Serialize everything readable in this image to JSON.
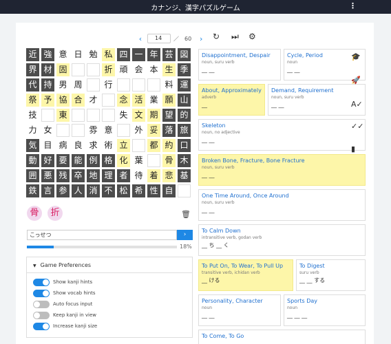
{
  "app": {
    "title": "カナンジ、漢字パズルゲーム",
    "menu_icon": "kebab-icon"
  },
  "pager": {
    "prev": "‹",
    "next": "›",
    "page": "14",
    "sep": "／",
    "total": "60"
  },
  "controls": {
    "restart_icon": "↻",
    "skip_icon": "⏭",
    "tools_icon": "⚙"
  },
  "board": {
    "rows": [
      [
        "近",
        "強",
        "意",
        "日",
        "勉",
        "私",
        "四",
        "一",
        "年",
        "芸",
        "図"
      ],
      [
        "界",
        "材",
        "固",
        "",
        "",
        "折",
        "頑",
        "会",
        "本",
        "生",
        "季"
      ],
      [
        "代",
        "持",
        "男",
        "周",
        "",
        "行",
        "",
        "",
        "",
        "料",
        "運"
      ],
      [
        "祭",
        "予",
        "協",
        "合",
        "才",
        "",
        "念",
        "活",
        "業",
        "願",
        "山"
      ],
      [
        "技",
        "",
        "東",
        "",
        "",
        "",
        "失",
        "文",
        "期",
        "望",
        "的"
      ],
      [
        "力",
        "女",
        "",
        "",
        "雰",
        "意",
        "",
        "外",
        "妥",
        "落",
        "旅"
      ],
      [
        "気",
        "目",
        "病",
        "良",
        "求",
        "術",
        "立",
        "",
        "都",
        "約",
        "口"
      ],
      [
        "動",
        "好",
        "要",
        "能",
        "例",
        "格",
        "化",
        "葉",
        "",
        "骨",
        "木"
      ],
      [
        "囲",
        "悪",
        "残",
        "卒",
        "地",
        "理",
        "者",
        "待",
        "着",
        "悲",
        "基"
      ],
      [
        "鉄",
        "言",
        "参",
        "人",
        "消",
        "不",
        "松",
        "希",
        "性",
        "自",
        ""
      ]
    ],
    "styles": [
      [
        "d",
        "d",
        "w",
        "w",
        "w",
        "y",
        "d",
        "d",
        "d",
        "d",
        "d"
      ],
      [
        "d",
        "d",
        "y",
        "e",
        "e",
        "y",
        "w",
        "w",
        "w",
        "y",
        "d"
      ],
      [
        "d",
        "d",
        "w",
        "w",
        "e",
        "w",
        "e",
        "e",
        "e",
        "w",
        "d"
      ],
      [
        "y",
        "y",
        "y",
        "y",
        "w",
        "e",
        "y",
        "y",
        "w",
        "y",
        "d"
      ],
      [
        "w",
        "e",
        "y",
        "e",
        "e",
        "e",
        "w",
        "y",
        "y",
        "d",
        "d"
      ],
      [
        "w",
        "w",
        "e",
        "e",
        "w",
        "w",
        "e",
        "w",
        "y",
        "d",
        "d"
      ],
      [
        "d",
        "w",
        "w",
        "w",
        "w",
        "w",
        "y",
        "e",
        "y",
        "y",
        "d"
      ],
      [
        "d",
        "d",
        "d",
        "d",
        "d",
        "d",
        "y",
        "w",
        "e",
        "y",
        "d"
      ],
      [
        "d",
        "d",
        "d",
        "d",
        "d",
        "d",
        "d",
        "w",
        "y",
        "y",
        "d"
      ],
      [
        "d",
        "d",
        "d",
        "d",
        "d",
        "d",
        "d",
        "d",
        "d",
        "d",
        "e"
      ]
    ]
  },
  "selected": [
    "骨",
    "折"
  ],
  "answer": {
    "value": "こっせつ",
    "submit_icon": "›"
  },
  "progress": {
    "percent": 18,
    "label": "18%"
  },
  "prefs": {
    "title": "Game Preferences",
    "options": [
      {
        "label": "Show kanji hints",
        "on": true
      },
      {
        "label": "Show vocab hints",
        "on": true
      },
      {
        "label": "Auto focus input",
        "on": false
      },
      {
        "label": "Keep kanji in view",
        "on": false
      },
      {
        "label": "Increase kanji size",
        "on": true
      }
    ]
  },
  "vocab": [
    {
      "en": "Disappointment, Despair",
      "pos": "noun, suru verb",
      "jp": "__ __",
      "hl": false
    },
    {
      "en": "Cycle, Period",
      "pos": "noun",
      "jp": "__ __",
      "hl": false
    },
    {
      "en": "About, Approximately",
      "pos": "adverb",
      "jp": "__",
      "hl": true
    },
    {
      "en": "Demand, Requirement",
      "pos": "noun, suru verb",
      "jp": "__ __",
      "hl": false
    },
    {
      "en": "Skeleton",
      "pos": "noun, no adjective",
      "jp": "__ __",
      "hl": false
    },
    {
      "en": "Broken Bone, Fracture, Bone Fracture",
      "pos": "noun, suru verb",
      "jp": "__ __",
      "hl": true
    },
    {
      "en": "One Time Around, Once Around",
      "pos": "noun, suru verb",
      "jp": "__ __",
      "hl": false
    },
    {
      "en": "To Calm Down",
      "pos": "intransitive verb, godan verb",
      "jp": "__ ち __ く",
      "hl": false
    },
    {
      "en": "To Put On, To Wear, To Pull Up",
      "pos": "transitive verb, ichidan verb",
      "jp": "__ ける",
      "hl": true
    },
    {
      "en": "To Digest",
      "pos": "suru verb",
      "jp": "__ __ する",
      "hl": false
    },
    {
      "en": "Personality, Character",
      "pos": "noun",
      "jp": "__ __",
      "hl": false
    },
    {
      "en": "Sports Day",
      "pos": "noun",
      "jp": "__ __ __",
      "hl": false
    },
    {
      "en": "To Come, To Go",
      "pos": "",
      "jp": "",
      "hl": false
    }
  ],
  "sidebar": [
    "graduation-cap-icon",
    "rocket-icon",
    "spell-check-icon",
    "double-check-icon",
    "bar-chart-icon"
  ],
  "colors": {
    "topbar": "#1f2432",
    "accent": "#1e88e5",
    "highlight": "#fdf6a9",
    "tile": "#4c4c4c",
    "pink": "#e0338e"
  }
}
